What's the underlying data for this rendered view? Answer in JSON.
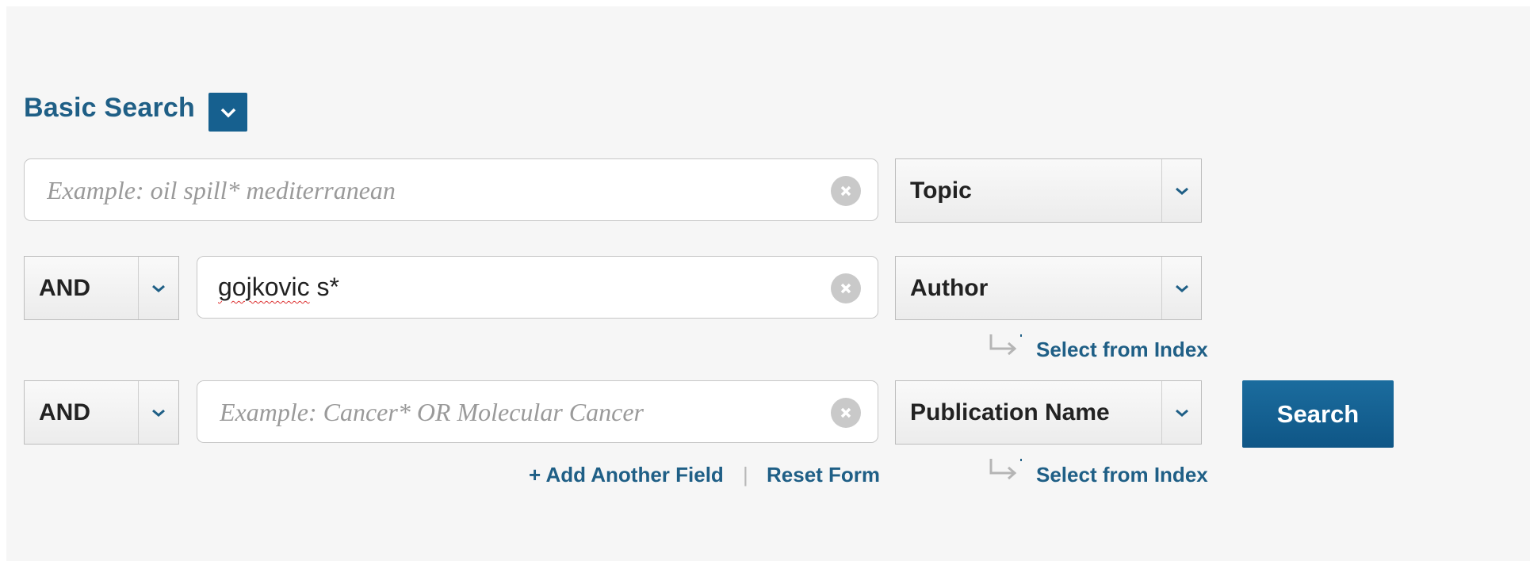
{
  "basic_search": {
    "title": "Basic Search",
    "colors": {
      "accent": "#1f5f86",
      "toggle_bg": "#16608f",
      "button_bg": "#0f5686"
    }
  },
  "rows": [
    {
      "operator": null,
      "value": "",
      "placeholder": "Example: oil spill* mediterranean",
      "field": "Topic"
    },
    {
      "operator": "AND",
      "value": "gojkovic s*",
      "value_misspelled_part": "gojkovic",
      "value_rest": " s*",
      "placeholder": "",
      "field": "Author",
      "index_link": "Select from Index"
    },
    {
      "operator": "AND",
      "value": "",
      "placeholder": "Example: Cancer* OR Molecular Cancer",
      "field": "Publication Name",
      "index_link": "Select from Index"
    }
  ],
  "actions": {
    "add_field": "+ Add Another Field",
    "separator": "|",
    "reset": "Reset Form",
    "search": "Search"
  },
  "icons": {
    "toggle": "chevron-down-icon",
    "clear": "clear-circle-icon",
    "dropdown": "chevron-down-icon",
    "index": "arrow-turn-right-icon"
  }
}
